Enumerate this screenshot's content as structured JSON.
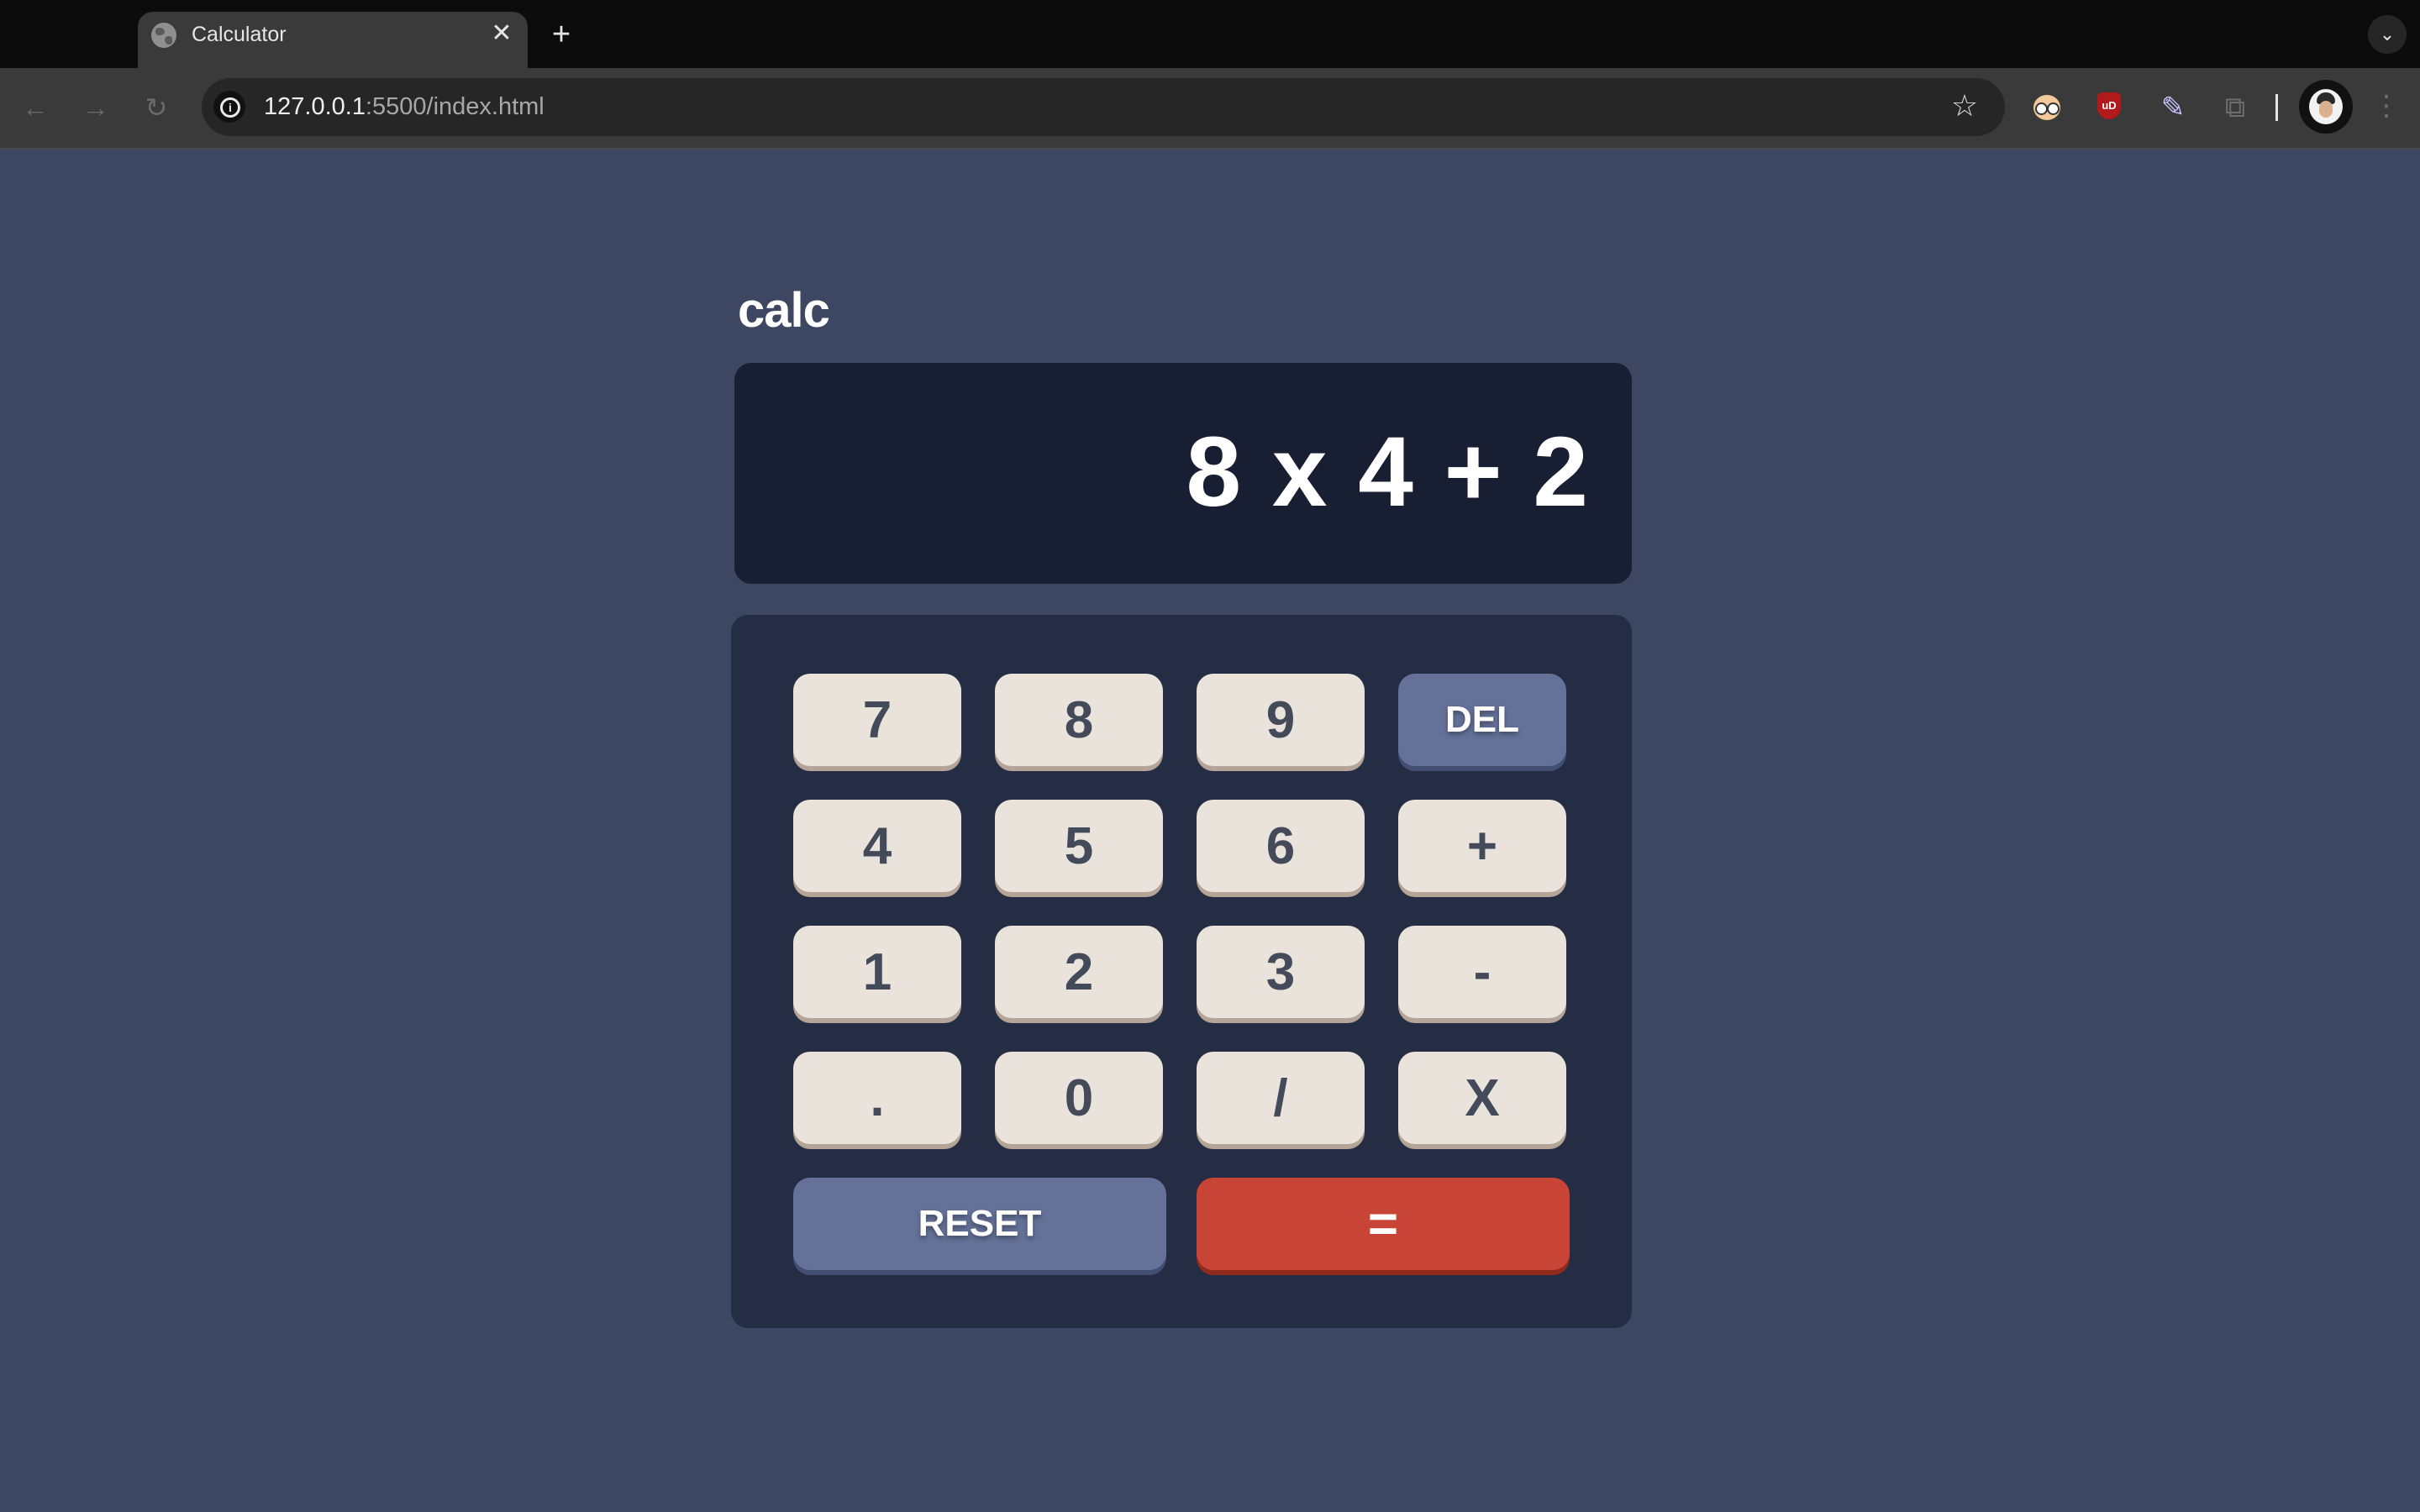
{
  "browser": {
    "tab_title": "Calculator",
    "url_host": "127.0.0.1",
    "url_path": ":5500/index.html",
    "icons": {
      "favicon": "globe-icon",
      "close_tab": "close-icon",
      "new_tab": "plus-icon",
      "tab_search": "chevron-down-icon",
      "back": "arrow-left-icon",
      "forward": "arrow-right-icon",
      "reload": "reload-icon",
      "site_info": "info-icon",
      "bookmark": "star-icon",
      "extensions": "puzzle-icon",
      "menu": "kebab-menu-icon"
    },
    "glyphs": {
      "close": "✕",
      "new_tab": "+",
      "tab_menu": "⌄",
      "back": "←",
      "forward": "→",
      "reload": "↻",
      "info": "i",
      "star": "☆",
      "ublock": "uD",
      "dropper": "✎",
      "puzzle": "⧉",
      "kebab": "⋮"
    }
  },
  "calculator": {
    "title": "calc",
    "display": "8 x 4 + 2",
    "keys": {
      "k7": "7",
      "k8": "8",
      "k9": "9",
      "del": "DEL",
      "k4": "4",
      "k5": "5",
      "k6": "6",
      "plus": "+",
      "k1": "1",
      "k2": "2",
      "k3": "3",
      "minus": "-",
      "dot": ".",
      "k0": "0",
      "divide": "/",
      "times": "X",
      "reset": "RESET",
      "equals": "="
    },
    "colors": {
      "page_bg": "#3d4762",
      "screen_bg": "#181f32",
      "keypad_bg": "#252d44",
      "key_bg": "#eae3dc",
      "key_text": "#434a59",
      "fn_key_bg": "#647198",
      "equals_bg": "#c74436"
    }
  }
}
